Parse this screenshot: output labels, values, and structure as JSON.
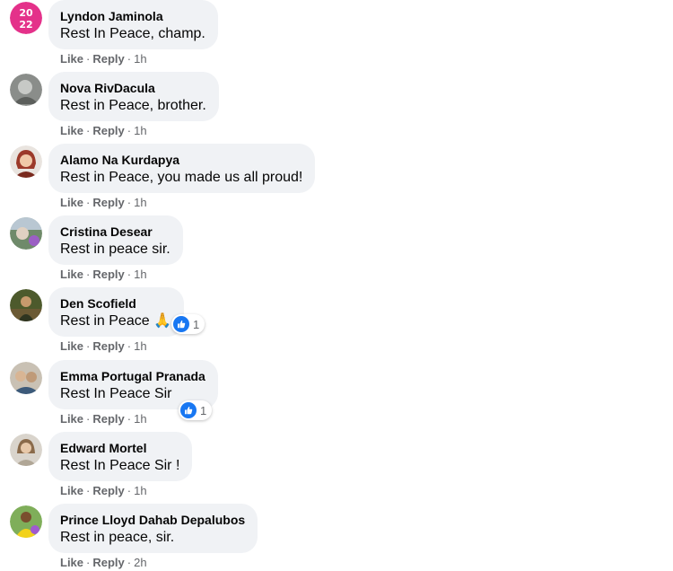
{
  "actions": {
    "like": "Like",
    "reply": "Reply",
    "separator": "·"
  },
  "colors": {
    "bubble": "#f0f2f5",
    "meta": "#65676b",
    "like_blue": "#1877f2"
  },
  "comments": [
    {
      "author": "Lyndon Jaminola",
      "text": "Rest In Peace, champ.",
      "time": "1h",
      "avatar": "profile-2022-badge"
    },
    {
      "author": "Nova RivDacula",
      "text": "Rest in Peace, brother.",
      "time": "1h",
      "avatar": "profile-photo"
    },
    {
      "author": "Alamo Na Kurdapya",
      "text": "Rest in Peace, you made us all proud!",
      "time": "1h",
      "avatar": "profile-photo"
    },
    {
      "author": "Cristina Desear",
      "text": "Rest in peace sir.",
      "time": "1h",
      "avatar": "profile-photo"
    },
    {
      "author": "Den Scofield",
      "text": "Rest in Peace",
      "emoji": "🙏",
      "time": "1h",
      "reaction": {
        "icon": "like-icon",
        "count": "1"
      },
      "avatar": "profile-photo"
    },
    {
      "author": "Emma Portugal Pranada",
      "text": "Rest In Peace Sir",
      "time": "1h",
      "reaction": {
        "icon": "like-icon",
        "count": "1"
      },
      "avatar": "profile-photo"
    },
    {
      "author": "Edward Mortel",
      "text": "Rest In Peace Sir !",
      "time": "1h",
      "avatar": "profile-photo"
    },
    {
      "author": "Prince Lloyd Dahab Depalubos",
      "text": "Rest in peace, sir.",
      "time": "2h",
      "avatar": "profile-photo"
    }
  ]
}
